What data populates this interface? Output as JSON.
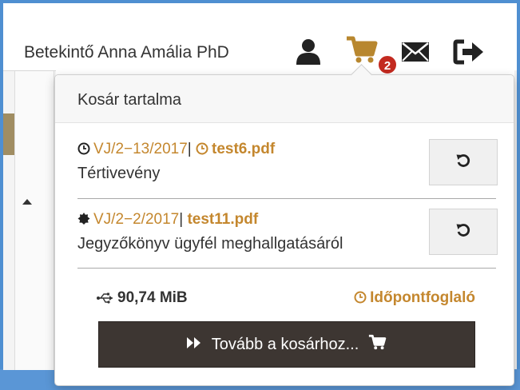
{
  "header": {
    "user_name": "Betekintő Anna Amália PhD",
    "icons": [
      "user-icon",
      "cart-icon",
      "envelope-icon",
      "logout-icon"
    ],
    "cart_count": "2"
  },
  "cart": {
    "title": "Kosár tartalma",
    "items": [
      {
        "status_icon": "clock-icon",
        "case_id": "VJ/2−13/2017",
        "separator": "|",
        "file_icon": "clock-icon",
        "file_name": "test6.pdf",
        "description": "Tértivevény",
        "action_icon": "undo-icon"
      },
      {
        "status_icon": "badge-icon",
        "case_id": "VJ/2−2/2017",
        "separator": "|",
        "file_name": "test11.pdf",
        "description": "Jegyzőkönyv ügyfél meghallgatásáról",
        "action_icon": "undo-icon"
      }
    ],
    "total_size": "90,74 MiB",
    "booking_label": "Időpontfoglaló",
    "proceed_label": "Tovább a kosárhoz..."
  },
  "colors": {
    "accent": "#c4872e",
    "badge": "#c32a20",
    "frame": "#4f8fd1",
    "button_dark": "#3d3632"
  }
}
